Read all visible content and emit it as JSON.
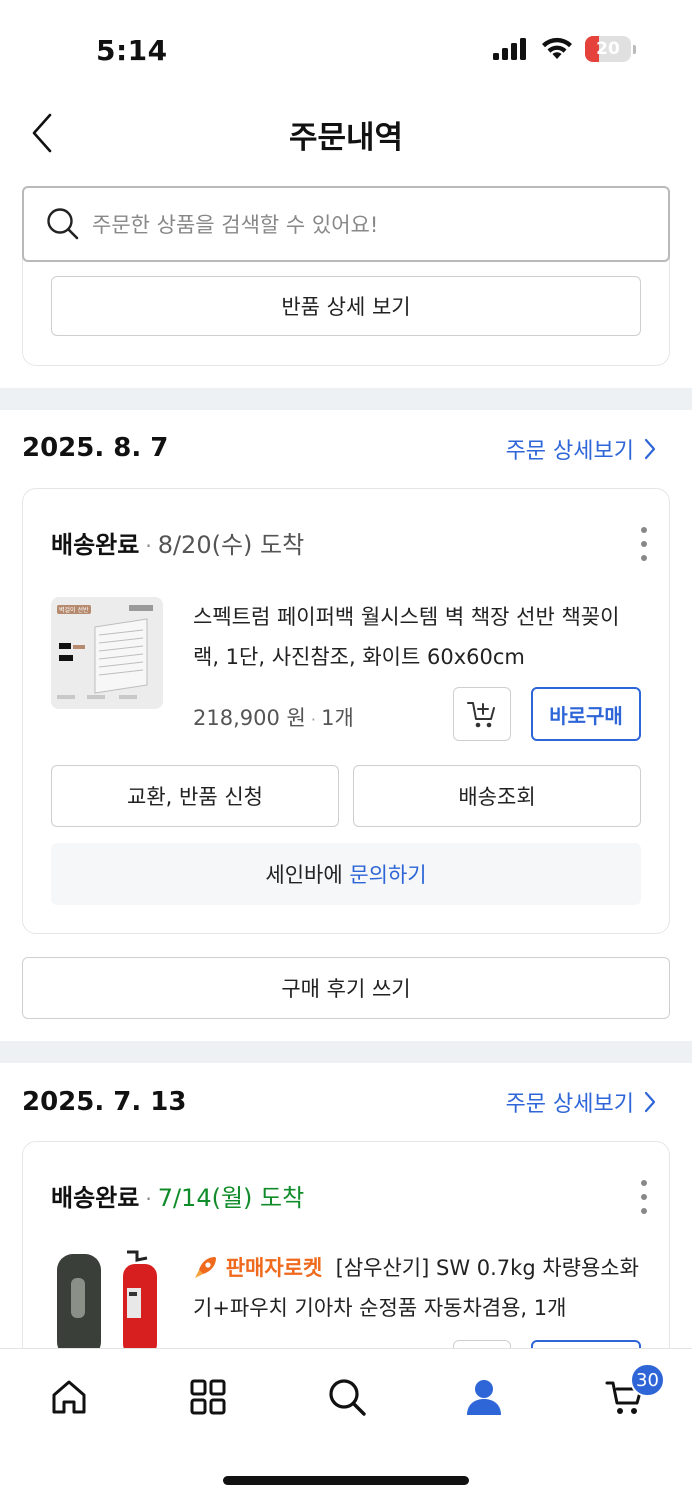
{
  "status_bar": {
    "time": "5:14",
    "battery": "20",
    "battery_level_pct": 20
  },
  "header": {
    "title": "주문내역"
  },
  "search": {
    "placeholder": "주문한 상품을 검색할 수 있어요!"
  },
  "prev_order": {
    "return_detail_label": "반품 상세 보기"
  },
  "orders": [
    {
      "date": "2025. 8. 7",
      "detail_link": "주문 상세보기",
      "status": "배송완료",
      "dot": "·",
      "arrival": "8/20(수) 도착",
      "product_name": "스펙트럼 페이퍼백 월시스템 벽 책장 선반 책꽂이 랙, 1단, 사진참조, 화이트 60x60cm",
      "price": "218,900 원",
      "qty": "1개",
      "buy_now": "바로구매",
      "exchange_return": "교환, 반품 신청",
      "track_shipping": "배송조회",
      "inquiry_prefix": "세인바에 ",
      "inquiry_link": "문의하기",
      "review": "구매 후기 쓰기",
      "thumb_label": "벽걸이 선반"
    },
    {
      "date": "2025. 7. 13",
      "detail_link": "주문 상세보기",
      "status": "배송완료",
      "dot": "·",
      "arrival": "7/14(월) 도착",
      "rocket_tag": "판매자로켓",
      "product_name": "[삼우산기] SW 0.7kg 차량용소화기+파우치 기아차 순정품 자동차겸용, 1개"
    }
  ],
  "tabbar": {
    "items": [
      "home-icon",
      "category-grid-icon",
      "search-icon",
      "my-page-icon",
      "cart-icon"
    ],
    "cart_count": "30",
    "active_color": "#2e66d8"
  },
  "colors": {
    "accent": "#2e66d8",
    "arrival_green": "#118c2a",
    "rocket_orange": "#ef6a1d"
  }
}
